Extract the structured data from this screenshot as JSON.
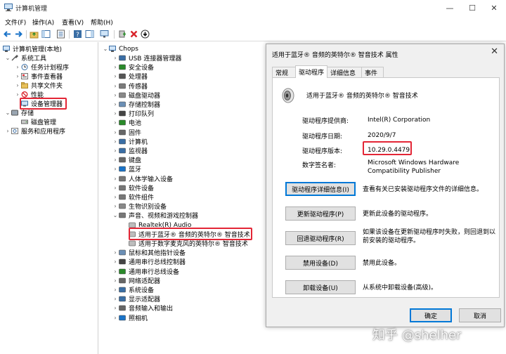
{
  "window": {
    "title": "计算机管理",
    "minimize": "—",
    "maximize": "☐",
    "close": "✕"
  },
  "menu": [
    "文件(F)",
    "操作(A)",
    "查看(V)",
    "帮助(H)"
  ],
  "left_tree": {
    "root": "计算机管理(本地)",
    "items": [
      {
        "label": "系统工具",
        "icon": "tools-icon"
      },
      {
        "label": "任务计划程序",
        "icon": "clock-icon"
      },
      {
        "label": "事件查看器",
        "icon": "event-icon"
      },
      {
        "label": "共享文件夹",
        "icon": "folder-icon"
      },
      {
        "label": "性能",
        "icon": "no-icon"
      },
      {
        "label": "设备管理器",
        "icon": "device-manager-icon"
      },
      {
        "label": "存储",
        "icon": "storage-icon"
      },
      {
        "label": "磁盘管理",
        "icon": "disk-icon"
      },
      {
        "label": "服务和应用程序",
        "icon": "services-icon"
      }
    ]
  },
  "device_tree": {
    "root": "Chops",
    "items": [
      "USB 连接器管理器",
      "安全设备",
      "处理器",
      "传感器",
      "磁盘驱动器",
      "存储控制器",
      "打印队列",
      "电池",
      "固件",
      "计算机",
      "监视器",
      "键盘",
      "蓝牙",
      "人体学输入设备",
      "软件设备",
      "软件组件",
      "生物识别设备",
      "声音、视频和游戏控制器"
    ],
    "audio_children": [
      "Realtek(R) Audio",
      "适用于蓝牙® 音频的英特尔® 智音技术",
      "适用于数字麦克风的英特尔® 智音技术"
    ],
    "items_after": [
      "鼠标和其他指针设备",
      "通用串行总线控制器",
      "通用串行总线设备",
      "网络适配器",
      "系统设备",
      "显示适配器",
      "音频输入和输出",
      "照相机"
    ]
  },
  "dialog": {
    "title": "适用于蓝牙® 音频的英特尔® 智音技术 属性",
    "close": "✕",
    "tabs": [
      "常规",
      "驱动程序",
      "详细信息",
      "事件"
    ],
    "active_tab": "驱动程序",
    "device_name": "适用于蓝牙® 音频的英特尔® 智音技术",
    "props": [
      {
        "label": "驱动程序提供商:",
        "value": "Intel(R) Corporation"
      },
      {
        "label": "驱动程序日期:",
        "value": "2020/9/7"
      },
      {
        "label": "驱动程序版本:",
        "value": "10.29.0.4479"
      },
      {
        "label": "数字签名者:",
        "value": "Microsoft Windows Hardware Compatibility Publisher"
      }
    ],
    "buttons": [
      {
        "label": "驱动程序详细信息(I)",
        "desc": "查看有关已安装驱动程序文件的详细信息。"
      },
      {
        "label": "更新驱动程序(P)",
        "desc": "更新此设备的驱动程序。"
      },
      {
        "label": "回退驱动程序(R)",
        "desc": "如果该设备在更新驱动程序时失败，则回退到以前安装的驱动程序。"
      },
      {
        "label": "禁用设备(D)",
        "desc": "禁用此设备。"
      },
      {
        "label": "卸载设备(U)",
        "desc": "从系统中卸载设备(高级)。"
      }
    ],
    "ok": "确定",
    "cancel": "取消"
  },
  "watermark": "知乎 @shelher",
  "colors": {
    "highlight": "#e32636",
    "accent": "#0078d7"
  }
}
